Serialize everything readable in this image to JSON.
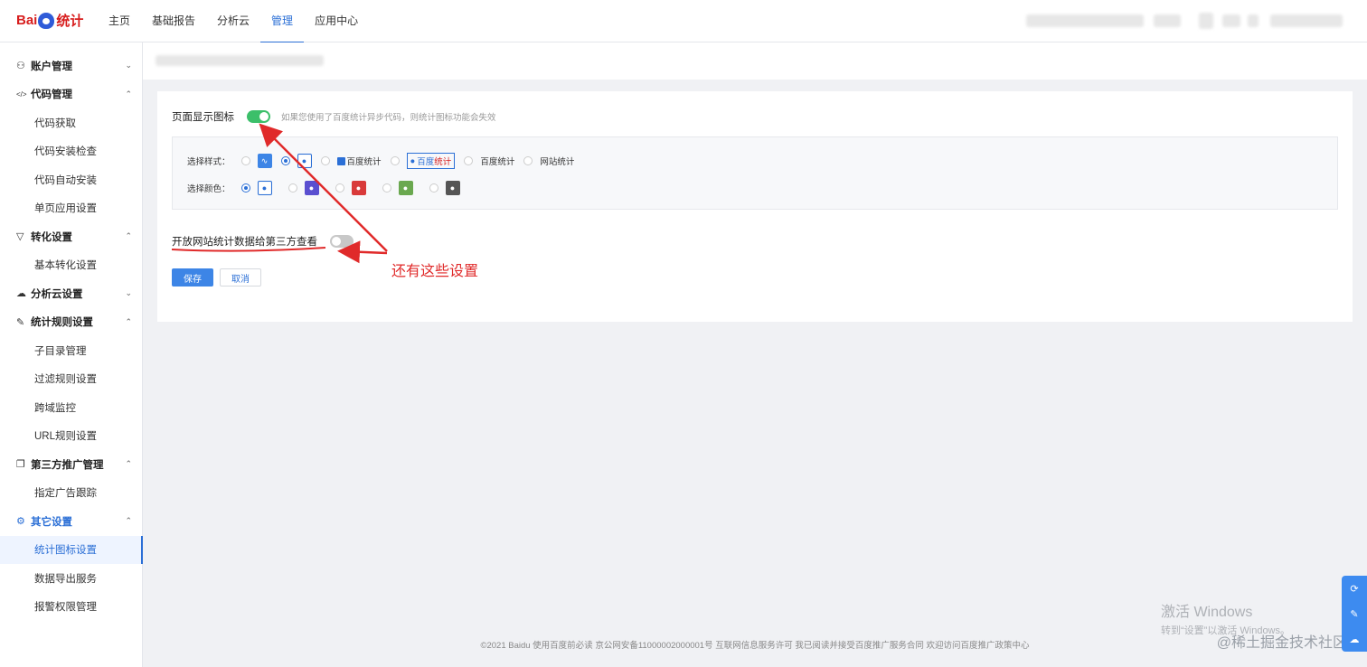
{
  "header": {
    "logo_prefix": "Bai",
    "logo_suffix": "统计",
    "nav": [
      "主页",
      "基础报告",
      "分析云",
      "管理",
      "应用中心"
    ],
    "nav_active": "管理"
  },
  "sidebar": {
    "items": [
      {
        "type": "group",
        "label": "账户管理",
        "icon": "user-icon",
        "expanded": false
      },
      {
        "type": "group",
        "label": "代码管理",
        "icon": "code-icon",
        "expanded": true
      },
      {
        "type": "sub",
        "label": "代码获取"
      },
      {
        "type": "sub",
        "label": "代码安装检查"
      },
      {
        "type": "sub",
        "label": "代码自动安装"
      },
      {
        "type": "sub",
        "label": "单页应用设置"
      },
      {
        "type": "group",
        "label": "转化设置",
        "icon": "filter-icon",
        "expanded": true
      },
      {
        "type": "sub",
        "label": "基本转化设置"
      },
      {
        "type": "group",
        "label": "分析云设置",
        "icon": "cloud-icon",
        "expanded": false
      },
      {
        "type": "group",
        "label": "统计规则设置",
        "icon": "edit-icon",
        "expanded": true
      },
      {
        "type": "sub",
        "label": "子目录管理"
      },
      {
        "type": "sub",
        "label": "过滤规则设置"
      },
      {
        "type": "sub",
        "label": "跨域监控"
      },
      {
        "type": "sub",
        "label": "URL规则设置"
      },
      {
        "type": "group",
        "label": "第三方推广管理",
        "icon": "copy-icon",
        "expanded": true
      },
      {
        "type": "sub",
        "label": "指定广告跟踪"
      },
      {
        "type": "group",
        "label": "其它设置",
        "icon": "gear-icon",
        "expanded": true,
        "active": true
      },
      {
        "type": "sub",
        "label": "统计图标设置",
        "selected": true
      },
      {
        "type": "sub",
        "label": "数据导出服务"
      },
      {
        "type": "sub",
        "label": "报警权限管理"
      }
    ]
  },
  "settings": {
    "show_icon_label": "页面显示图标",
    "show_icon_on": true,
    "show_icon_hint": "如果您使用了百度统计异步代码，则统计图标功能会失效",
    "style_label": "选择样式：",
    "style_options": [
      {
        "kind": "chart-badge",
        "checked": false
      },
      {
        "kind": "paw-badge",
        "checked": true
      },
      {
        "kind": "text",
        "text": "百度统计",
        "mini": true,
        "checked": false
      },
      {
        "kind": "framed-text",
        "text_blue": "百度",
        "text_red": "统计",
        "checked": false
      },
      {
        "kind": "text",
        "text": "百度统计",
        "mini": false,
        "checked": false
      },
      {
        "kind": "text",
        "text": "网站统计",
        "mini": false,
        "checked": false
      }
    ],
    "color_label": "选择颜色：",
    "color_options": [
      {
        "color": "#2b6fd6",
        "framed": true,
        "checked": true
      },
      {
        "color": "#5a4fd0",
        "framed": false,
        "checked": false
      },
      {
        "color": "#d93a3a",
        "framed": false,
        "checked": false
      },
      {
        "color": "#6aa84f",
        "framed": false,
        "checked": false
      },
      {
        "color": "#555555",
        "framed": false,
        "checked": false
      }
    ],
    "open_data_label": "开放网站统计数据给第三方查看",
    "open_data_on": false,
    "save_label": "保存",
    "cancel_label": "取消"
  },
  "annotation": "还有这些设置",
  "footer": "©2021 Baidu 使用百度前必读 京公网安备11000002000001号 互联网信息服务许可 我已阅读并接受百度推广服务合同 欢迎访问百度推广政策中心",
  "watermark": {
    "line1": "激活 Windows",
    "line2": "转到“设置”以激活 Windows。",
    "site": "@稀土掘金技术社区"
  },
  "accent_color": "#2b6fd6",
  "toggle_on_color": "#3cbf6a",
  "annotation_color": "#e02a2a"
}
